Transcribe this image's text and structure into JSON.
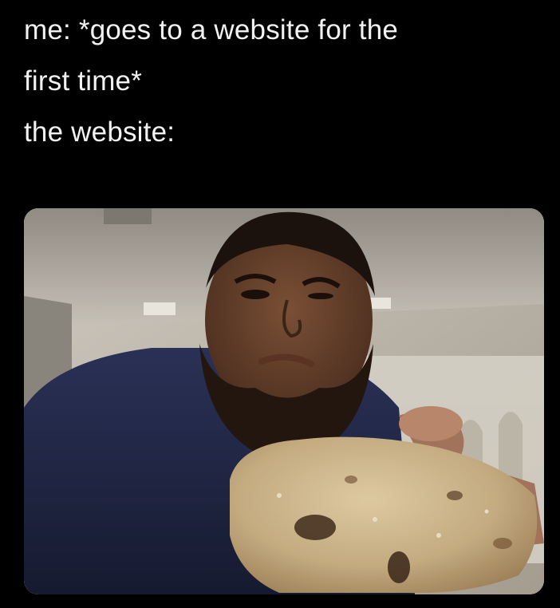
{
  "caption": {
    "line1": "me: *goes to a website for the",
    "line2": "first time*",
    "line3": "the website:"
  },
  "photo": {
    "subject": "man holding a chocolate chip cookie toward the camera"
  },
  "colors": {
    "background": "#000000",
    "text": "#f2f2f2",
    "shirt": "#1e2440",
    "cookie": "#c9b48e"
  }
}
